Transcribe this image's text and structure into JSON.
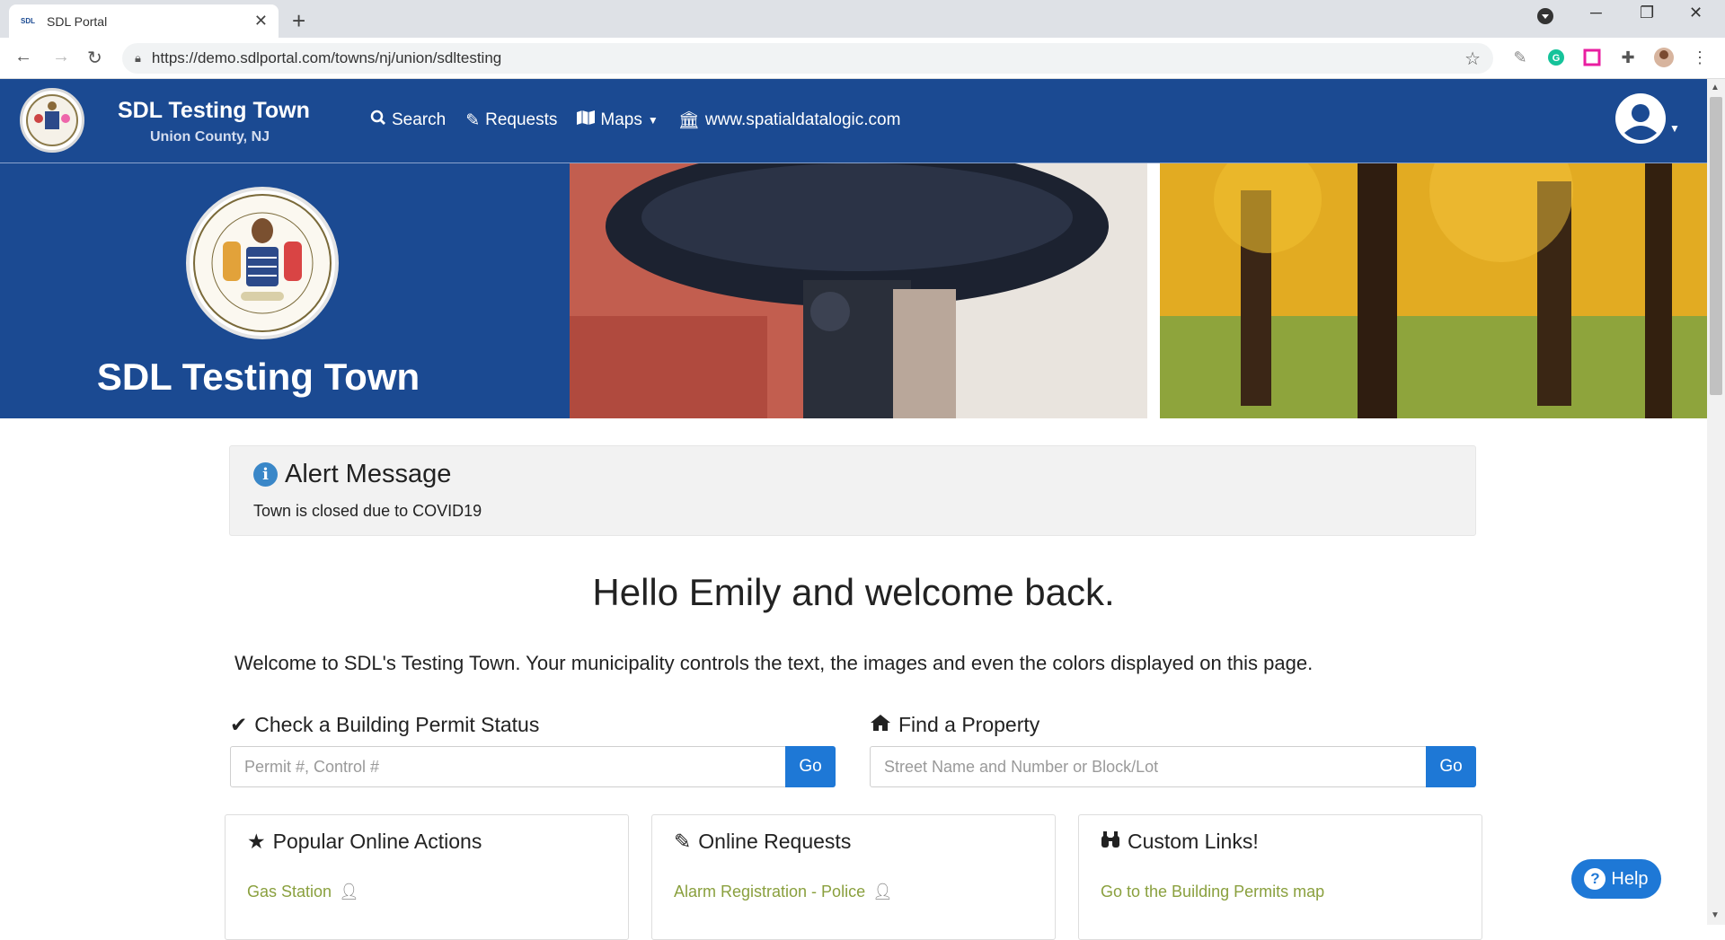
{
  "browser": {
    "tab_title": "SDL Portal",
    "favicon_text": "SDL",
    "url": "https://demo.sdlportal.com/towns/nj/union/sdltesting"
  },
  "site": {
    "town_name": "SDL Testing Town",
    "county": "Union County, NJ",
    "nav": {
      "search": "Search",
      "requests": "Requests",
      "maps": "Maps",
      "website": "www.spatialdatalogic.com"
    },
    "brand_color": "#1b4a92",
    "accent_color": "#1e78d6"
  },
  "banner": {
    "title": "SDL Testing Town"
  },
  "alert": {
    "title": "Alert Message",
    "message": "Town is closed due to COVID19"
  },
  "greeting": "Hello Emily and welcome back.",
  "welcome_text": "Welcome to SDL's Testing Town. Your municipality controls the text, the images and even the colors displayed on this page.",
  "permit": {
    "label": "Check a Building Permit Status",
    "placeholder": "Permit #, Control #",
    "go": "Go"
  },
  "property": {
    "label": "Find a Property",
    "placeholder": "Street Name and Number or Block/Lot",
    "go": "Go"
  },
  "cards": [
    {
      "title": "Popular Online Actions",
      "link": "Gas Station",
      "icon": "star-icon"
    },
    {
      "title": "Online Requests",
      "link": "Alarm Registration - Police",
      "icon": "pencil-icon"
    },
    {
      "title": "Custom Links!",
      "link": "Go to the Building Permits map",
      "icon": "binoculars-icon"
    }
  ],
  "help_label": "Help"
}
